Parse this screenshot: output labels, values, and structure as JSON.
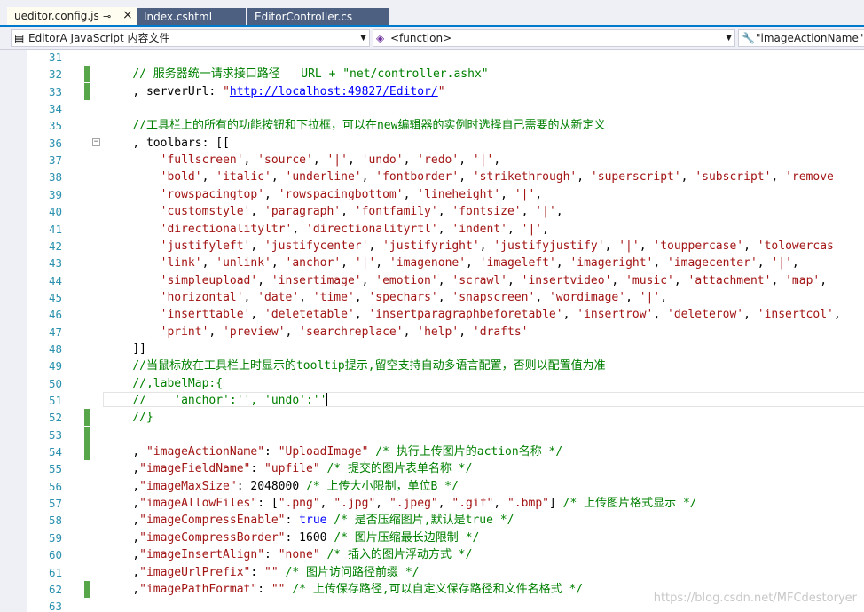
{
  "tabs": [
    {
      "label": "ueditor.config.js",
      "pin": "⊸",
      "close": "×"
    },
    {
      "label": "Index.cshtml"
    },
    {
      "label": "EditorController.cs"
    }
  ],
  "navbar": {
    "project": "EditorA JavaScript 内容文件",
    "scope": "<function>",
    "member": "\"imageActionName\""
  },
  "lines": [
    {
      "n": "31",
      "indent": 0,
      "segs": []
    },
    {
      "n": "32",
      "indent": 4,
      "changed": true,
      "segs": [
        {
          "t": "// 服务器统一请求接口路径   URL + \"net/controller.ashx\"",
          "c": "cmt"
        }
      ]
    },
    {
      "n": "33",
      "indent": 4,
      "changed": true,
      "segs": [
        {
          "t": ", serverUrl: ",
          "c": "pl"
        },
        {
          "t": "\"",
          "c": "str"
        },
        {
          "t": "http://localhost:49827/Editor/",
          "c": "url"
        },
        {
          "t": "\"",
          "c": "str"
        }
      ]
    },
    {
      "n": "34",
      "indent": 0,
      "segs": []
    },
    {
      "n": "35",
      "indent": 4,
      "segs": [
        {
          "t": "//工具栏上的所有的功能按钮和下拉框，可以在new编辑器的实例时选择自己需要的从新定义",
          "c": "cmt"
        }
      ]
    },
    {
      "n": "36",
      "indent": 4,
      "fold": true,
      "segs": [
        {
          "t": ", toolbars: [[",
          "c": "pl"
        }
      ]
    },
    {
      "n": "37",
      "indent": 8,
      "segs": [
        {
          "t": "'fullscreen'",
          "c": "str"
        },
        {
          "t": ", ",
          "c": "pl"
        },
        {
          "t": "'source'",
          "c": "str"
        },
        {
          "t": ", ",
          "c": "pl"
        },
        {
          "t": "'|'",
          "c": "str"
        },
        {
          "t": ", ",
          "c": "pl"
        },
        {
          "t": "'undo'",
          "c": "str"
        },
        {
          "t": ", ",
          "c": "pl"
        },
        {
          "t": "'redo'",
          "c": "str"
        },
        {
          "t": ", ",
          "c": "pl"
        },
        {
          "t": "'|'",
          "c": "str"
        },
        {
          "t": ",",
          "c": "pl"
        }
      ]
    },
    {
      "n": "38",
      "indent": 8,
      "segs": [
        {
          "t": "'bold'",
          "c": "str"
        },
        {
          "t": ", ",
          "c": "pl"
        },
        {
          "t": "'italic'",
          "c": "str"
        },
        {
          "t": ", ",
          "c": "pl"
        },
        {
          "t": "'underline'",
          "c": "str"
        },
        {
          "t": ", ",
          "c": "pl"
        },
        {
          "t": "'fontborder'",
          "c": "str"
        },
        {
          "t": ", ",
          "c": "pl"
        },
        {
          "t": "'strikethrough'",
          "c": "str"
        },
        {
          "t": ", ",
          "c": "pl"
        },
        {
          "t": "'superscript'",
          "c": "str"
        },
        {
          "t": ", ",
          "c": "pl"
        },
        {
          "t": "'subscript'",
          "c": "str"
        },
        {
          "t": ", ",
          "c": "pl"
        },
        {
          "t": "'remove",
          "c": "str"
        }
      ]
    },
    {
      "n": "39",
      "indent": 8,
      "segs": [
        {
          "t": "'rowspacingtop'",
          "c": "str"
        },
        {
          "t": ", ",
          "c": "pl"
        },
        {
          "t": "'rowspacingbottom'",
          "c": "str"
        },
        {
          "t": ", ",
          "c": "pl"
        },
        {
          "t": "'lineheight'",
          "c": "str"
        },
        {
          "t": ", ",
          "c": "pl"
        },
        {
          "t": "'|'",
          "c": "str"
        },
        {
          "t": ",",
          "c": "pl"
        }
      ]
    },
    {
      "n": "40",
      "indent": 8,
      "segs": [
        {
          "t": "'customstyle'",
          "c": "str"
        },
        {
          "t": ", ",
          "c": "pl"
        },
        {
          "t": "'paragraph'",
          "c": "str"
        },
        {
          "t": ", ",
          "c": "pl"
        },
        {
          "t": "'fontfamily'",
          "c": "str"
        },
        {
          "t": ", ",
          "c": "pl"
        },
        {
          "t": "'fontsize'",
          "c": "str"
        },
        {
          "t": ", ",
          "c": "pl"
        },
        {
          "t": "'|'",
          "c": "str"
        },
        {
          "t": ",",
          "c": "pl"
        }
      ]
    },
    {
      "n": "41",
      "indent": 8,
      "segs": [
        {
          "t": "'directionalityltr'",
          "c": "str"
        },
        {
          "t": ", ",
          "c": "pl"
        },
        {
          "t": "'directionalityrtl'",
          "c": "str"
        },
        {
          "t": ", ",
          "c": "pl"
        },
        {
          "t": "'indent'",
          "c": "str"
        },
        {
          "t": ", ",
          "c": "pl"
        },
        {
          "t": "'|'",
          "c": "str"
        },
        {
          "t": ",",
          "c": "pl"
        }
      ]
    },
    {
      "n": "42",
      "indent": 8,
      "segs": [
        {
          "t": "'justifyleft'",
          "c": "str"
        },
        {
          "t": ", ",
          "c": "pl"
        },
        {
          "t": "'justifycenter'",
          "c": "str"
        },
        {
          "t": ", ",
          "c": "pl"
        },
        {
          "t": "'justifyright'",
          "c": "str"
        },
        {
          "t": ", ",
          "c": "pl"
        },
        {
          "t": "'justifyjustify'",
          "c": "str"
        },
        {
          "t": ", ",
          "c": "pl"
        },
        {
          "t": "'|'",
          "c": "str"
        },
        {
          "t": ", ",
          "c": "pl"
        },
        {
          "t": "'touppercase'",
          "c": "str"
        },
        {
          "t": ", ",
          "c": "pl"
        },
        {
          "t": "'tolowercas",
          "c": "str"
        }
      ]
    },
    {
      "n": "43",
      "indent": 8,
      "segs": [
        {
          "t": "'link'",
          "c": "str"
        },
        {
          "t": ", ",
          "c": "pl"
        },
        {
          "t": "'unlink'",
          "c": "str"
        },
        {
          "t": ", ",
          "c": "pl"
        },
        {
          "t": "'anchor'",
          "c": "str"
        },
        {
          "t": ", ",
          "c": "pl"
        },
        {
          "t": "'|'",
          "c": "str"
        },
        {
          "t": ", ",
          "c": "pl"
        },
        {
          "t": "'imagenone'",
          "c": "str"
        },
        {
          "t": ", ",
          "c": "pl"
        },
        {
          "t": "'imageleft'",
          "c": "str"
        },
        {
          "t": ", ",
          "c": "pl"
        },
        {
          "t": "'imageright'",
          "c": "str"
        },
        {
          "t": ", ",
          "c": "pl"
        },
        {
          "t": "'imagecenter'",
          "c": "str"
        },
        {
          "t": ", ",
          "c": "pl"
        },
        {
          "t": "'|'",
          "c": "str"
        },
        {
          "t": ",",
          "c": "pl"
        }
      ]
    },
    {
      "n": "44",
      "indent": 8,
      "segs": [
        {
          "t": "'simpleupload'",
          "c": "str"
        },
        {
          "t": ", ",
          "c": "pl"
        },
        {
          "t": "'insertimage'",
          "c": "str"
        },
        {
          "t": ", ",
          "c": "pl"
        },
        {
          "t": "'emotion'",
          "c": "str"
        },
        {
          "t": ", ",
          "c": "pl"
        },
        {
          "t": "'scrawl'",
          "c": "str"
        },
        {
          "t": ", ",
          "c": "pl"
        },
        {
          "t": "'insertvideo'",
          "c": "str"
        },
        {
          "t": ", ",
          "c": "pl"
        },
        {
          "t": "'music'",
          "c": "str"
        },
        {
          "t": ", ",
          "c": "pl"
        },
        {
          "t": "'attachment'",
          "c": "str"
        },
        {
          "t": ", ",
          "c": "pl"
        },
        {
          "t": "'map'",
          "c": "str"
        },
        {
          "t": ",",
          "c": "pl"
        }
      ]
    },
    {
      "n": "45",
      "indent": 8,
      "segs": [
        {
          "t": "'horizontal'",
          "c": "str"
        },
        {
          "t": ", ",
          "c": "pl"
        },
        {
          "t": "'date'",
          "c": "str"
        },
        {
          "t": ", ",
          "c": "pl"
        },
        {
          "t": "'time'",
          "c": "str"
        },
        {
          "t": ", ",
          "c": "pl"
        },
        {
          "t": "'spechars'",
          "c": "str"
        },
        {
          "t": ", ",
          "c": "pl"
        },
        {
          "t": "'snapscreen'",
          "c": "str"
        },
        {
          "t": ", ",
          "c": "pl"
        },
        {
          "t": "'wordimage'",
          "c": "str"
        },
        {
          "t": ", ",
          "c": "pl"
        },
        {
          "t": "'|'",
          "c": "str"
        },
        {
          "t": ",",
          "c": "pl"
        }
      ]
    },
    {
      "n": "46",
      "indent": 8,
      "segs": [
        {
          "t": "'inserttable'",
          "c": "str"
        },
        {
          "t": ", ",
          "c": "pl"
        },
        {
          "t": "'deletetable'",
          "c": "str"
        },
        {
          "t": ", ",
          "c": "pl"
        },
        {
          "t": "'insertparagraphbeforetable'",
          "c": "str"
        },
        {
          "t": ", ",
          "c": "pl"
        },
        {
          "t": "'insertrow'",
          "c": "str"
        },
        {
          "t": ", ",
          "c": "pl"
        },
        {
          "t": "'deleterow'",
          "c": "str"
        },
        {
          "t": ", ",
          "c": "pl"
        },
        {
          "t": "'insertcol'",
          "c": "str"
        },
        {
          "t": ",",
          "c": "pl"
        }
      ]
    },
    {
      "n": "47",
      "indent": 8,
      "segs": [
        {
          "t": "'print'",
          "c": "str"
        },
        {
          "t": ", ",
          "c": "pl"
        },
        {
          "t": "'preview'",
          "c": "str"
        },
        {
          "t": ", ",
          "c": "pl"
        },
        {
          "t": "'searchreplace'",
          "c": "str"
        },
        {
          "t": ", ",
          "c": "pl"
        },
        {
          "t": "'help'",
          "c": "str"
        },
        {
          "t": ", ",
          "c": "pl"
        },
        {
          "t": "'drafts'",
          "c": "str"
        }
      ]
    },
    {
      "n": "48",
      "indent": 4,
      "segs": [
        {
          "t": "]]",
          "c": "pl"
        }
      ]
    },
    {
      "n": "49",
      "indent": 4,
      "segs": [
        {
          "t": "//当鼠标放在工具栏上时显示的tooltip提示,留空支持自动多语言配置，否则以配置值为准",
          "c": "cmt"
        }
      ]
    },
    {
      "n": "50",
      "indent": 4,
      "segs": [
        {
          "t": "//,labelMap:{",
          "c": "cmt"
        }
      ]
    },
    {
      "n": "51",
      "indent": 4,
      "current": true,
      "segs": [
        {
          "t": "//    'anchor':'', 'undo':''",
          "c": "cmt"
        },
        {
          "caret": true
        }
      ]
    },
    {
      "n": "52",
      "indent": 4,
      "changed": true,
      "segs": [
        {
          "t": "//}",
          "c": "cmt"
        }
      ]
    },
    {
      "n": "53",
      "indent": 0,
      "changed": true,
      "segs": []
    },
    {
      "n": "54",
      "indent": 4,
      "changed": true,
      "segs": [
        {
          "t": ", ",
          "c": "pl"
        },
        {
          "t": "\"imageActionName\"",
          "c": "str"
        },
        {
          "t": ": ",
          "c": "pl"
        },
        {
          "t": "\"UploadImage\"",
          "c": "str"
        },
        {
          "t": " /* 执行上传图片的action名称 */",
          "c": "cmt"
        }
      ]
    },
    {
      "n": "55",
      "indent": 4,
      "segs": [
        {
          "t": ",",
          "c": "pl"
        },
        {
          "t": "\"imageFieldName\"",
          "c": "str"
        },
        {
          "t": ": ",
          "c": "pl"
        },
        {
          "t": "\"upfile\"",
          "c": "str"
        },
        {
          "t": " /* 提交的图片表单名称 */",
          "c": "cmt"
        }
      ]
    },
    {
      "n": "56",
      "indent": 4,
      "segs": [
        {
          "t": ",",
          "c": "pl"
        },
        {
          "t": "\"imageMaxSize\"",
          "c": "str"
        },
        {
          "t": ": 2048000 ",
          "c": "pl"
        },
        {
          "t": "/* 上传大小限制，单位B */",
          "c": "cmt"
        }
      ]
    },
    {
      "n": "57",
      "indent": 4,
      "segs": [
        {
          "t": ",",
          "c": "pl"
        },
        {
          "t": "\"imageAllowFiles\"",
          "c": "str"
        },
        {
          "t": ": [",
          "c": "pl"
        },
        {
          "t": "\".png\"",
          "c": "str"
        },
        {
          "t": ", ",
          "c": "pl"
        },
        {
          "t": "\".jpg\"",
          "c": "str"
        },
        {
          "t": ", ",
          "c": "pl"
        },
        {
          "t": "\".jpeg\"",
          "c": "str"
        },
        {
          "t": ", ",
          "c": "pl"
        },
        {
          "t": "\".gif\"",
          "c": "str"
        },
        {
          "t": ", ",
          "c": "pl"
        },
        {
          "t": "\".bmp\"",
          "c": "str"
        },
        {
          "t": "] ",
          "c": "pl"
        },
        {
          "t": "/* 上传图片格式显示 */",
          "c": "cmt"
        }
      ]
    },
    {
      "n": "58",
      "indent": 4,
      "segs": [
        {
          "t": ",",
          "c": "pl"
        },
        {
          "t": "\"imageCompressEnable\"",
          "c": "str"
        },
        {
          "t": ": ",
          "c": "pl"
        },
        {
          "t": "true",
          "c": "kw"
        },
        {
          "t": " /* 是否压缩图片,默认是true */",
          "c": "cmt"
        }
      ]
    },
    {
      "n": "59",
      "indent": 4,
      "segs": [
        {
          "t": ",",
          "c": "pl"
        },
        {
          "t": "\"imageCompressBorder\"",
          "c": "str"
        },
        {
          "t": ": 1600 ",
          "c": "pl"
        },
        {
          "t": "/* 图片压缩最长边限制 */",
          "c": "cmt"
        }
      ]
    },
    {
      "n": "60",
      "indent": 4,
      "segs": [
        {
          "t": ",",
          "c": "pl"
        },
        {
          "t": "\"imageInsertAlign\"",
          "c": "str"
        },
        {
          "t": ": ",
          "c": "pl"
        },
        {
          "t": "\"none\"",
          "c": "str"
        },
        {
          "t": " /* 插入的图片浮动方式 */",
          "c": "cmt"
        }
      ]
    },
    {
      "n": "61",
      "indent": 4,
      "segs": [
        {
          "t": ",",
          "c": "pl"
        },
        {
          "t": "\"imageUrlPrefix\"",
          "c": "str"
        },
        {
          "t": ": ",
          "c": "pl"
        },
        {
          "t": "\"\"",
          "c": "str"
        },
        {
          "t": " /* 图片访问路径前缀 */",
          "c": "cmt"
        }
      ]
    },
    {
      "n": "62",
      "indent": 4,
      "changed": true,
      "segs": [
        {
          "t": ",",
          "c": "pl"
        },
        {
          "t": "\"imagePathFormat\"",
          "c": "str"
        },
        {
          "t": ": ",
          "c": "pl"
        },
        {
          "t": "\"\"",
          "c": "str"
        },
        {
          "t": " /* 上传保存路径,可以自定义保存路径和文件名格式 */",
          "c": "cmt"
        }
      ]
    },
    {
      "n": "63",
      "indent": 0,
      "segs": []
    }
  ],
  "watermark": "https://blog.csdn.net/MFCdestoryer",
  "colors": {
    "accent": "#007acc",
    "comment": "#008000",
    "string": "#a31515",
    "keyword": "#0000ff",
    "lineNumber": "#2b91af",
    "changeMarker": "#57a64a"
  },
  "icons": {
    "project": "project-file-icon",
    "scope": "function-cube-icon",
    "member": "wrench-icon",
    "dropdown": "chevron-down-icon"
  }
}
